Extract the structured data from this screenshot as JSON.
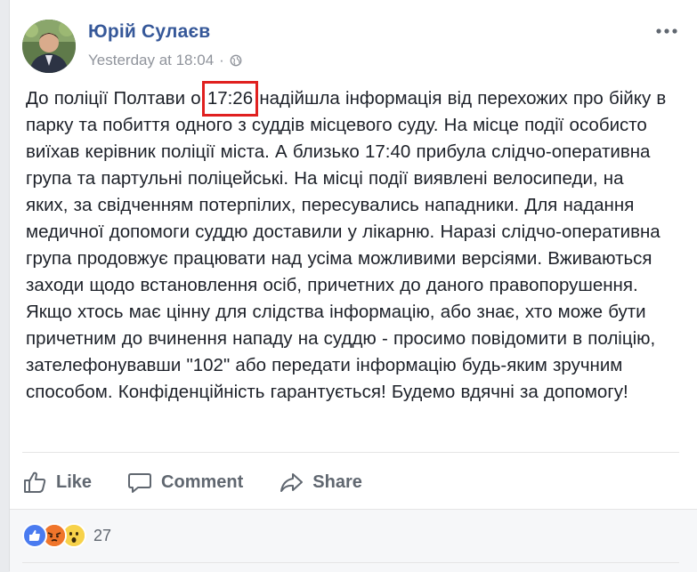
{
  "post": {
    "author": "Юрій Сулаєв",
    "timestamp": "Yesterday at 18:04",
    "separator": "·",
    "privacy_icon": "globe-icon",
    "more_icon": "more-options-icon",
    "body_before": "До поліції Полтави о ",
    "body_highlight": "17:26",
    "body_after": " надійшла інформація від перехожих про бійку в парку та побиття одного з суддів місцевого суду. На місце події особисто виїхав керівник поліції міста. А близько 17:40 прибула слідчо-оперативна група та партульні поліцейські. На місці події виявлені велосипеди, на яких, за свідченням потерпілих, пересувались нападники. Для надання медичної допомоги суддю доставили у лікарню. Наразі слідчо-оперативна група продовжує працювати над усіма можливими версіями. Вживаються заходи щодо встановлення осіб, причетних до даного правопорушення. Якщо хтось має цінну для слідства інформацію, або знає, хто може бути причетним до вчинення нападу на суддю - просимо повідомити в поліцію, зателефонувавши \"102\" або передати інформацію будь-яким зручним способом. Конфіденційність гарантується! Будемо вдячні за допомогу!",
    "highlight_color": "#e0201f"
  },
  "actions": {
    "like": "Like",
    "comment": "Comment",
    "share": "Share"
  },
  "reactions": {
    "types": [
      "like",
      "angry",
      "wow"
    ],
    "count": "27"
  },
  "colors": {
    "author_link": "#365899",
    "meta": "#90949c",
    "text": "#1d2129",
    "like_blue": "#4267b2"
  }
}
